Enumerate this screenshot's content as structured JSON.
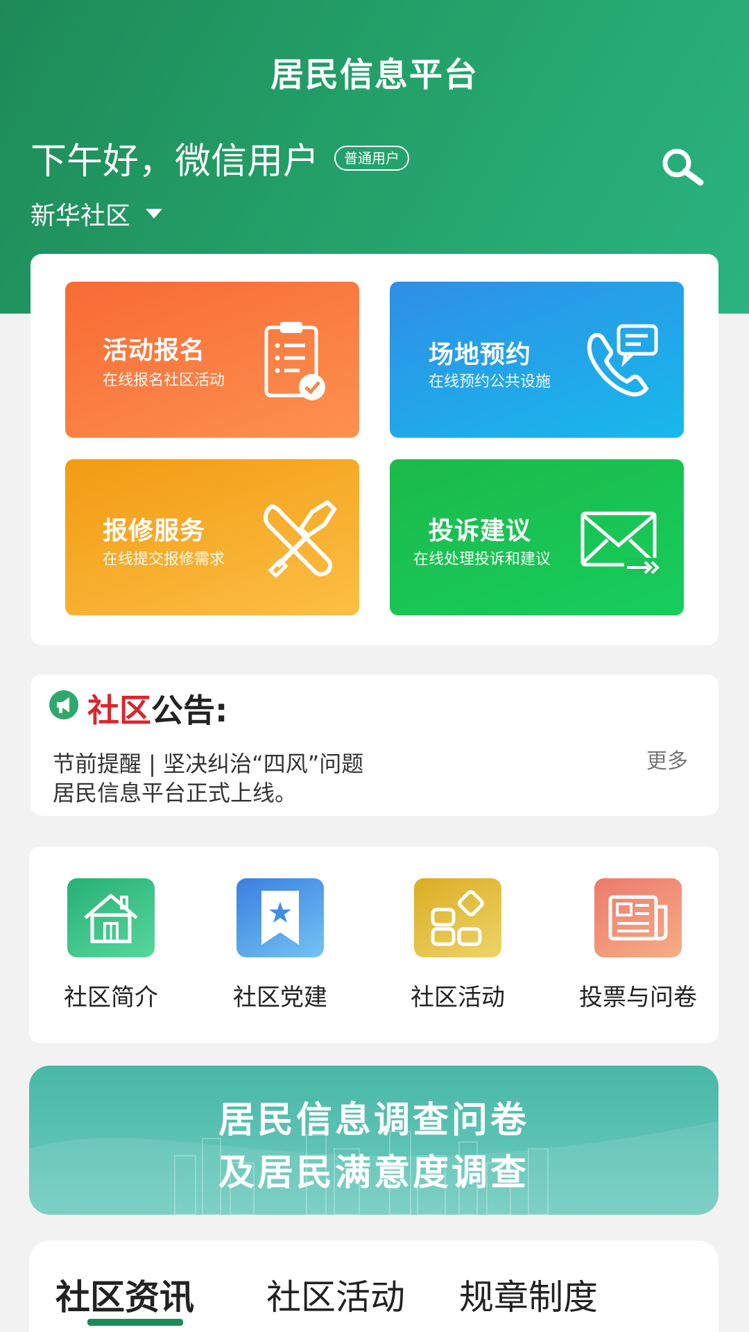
{
  "header": {
    "title": "居民信息平台",
    "greeting": "下午好，微信用户",
    "user_badge": "普通用户",
    "community": "新华社区",
    "search_icon": "search-icon",
    "color": "#24a46c"
  },
  "services": [
    {
      "title": "活动报名",
      "subtitle": "在线报名社区活动",
      "icon": "clipboard-check-icon",
      "color": "#f8743c"
    },
    {
      "title": "场地预约",
      "subtitle": "在线预约公共设施",
      "icon": "phone-chat-icon",
      "color": "#1ea8ea"
    },
    {
      "title": "报修服务",
      "subtitle": "在线提交报修需求",
      "icon": "wrench-hammer-icon",
      "color": "#f6aa26"
    },
    {
      "title": "投诉建议",
      "subtitle": "在线处理投诉和建议",
      "icon": "mail-forward-icon",
      "color": "#19c353"
    }
  ],
  "notice": {
    "title_red": "社区",
    "title_black": "公告:",
    "line1": "节前提醒 | 坚决纠治“四风”问题",
    "line2": "居民信息平台正式上线。",
    "more": "更多"
  },
  "quick_links": [
    {
      "label": "社区简介",
      "icon": "house-icon",
      "color": "#2dbd80"
    },
    {
      "label": "社区党建",
      "icon": "bookmark-star-icon",
      "color": "#3f8fe3"
    },
    {
      "label": "社区活动",
      "icon": "grid-apps-icon",
      "color": "#e0b934"
    },
    {
      "label": "投票与问卷",
      "icon": "newspaper-icon",
      "color": "#ee8275"
    }
  ],
  "banner": {
    "line1": "居民信息调查问卷",
    "line2": "及居民满意度调查"
  },
  "news_tabs": [
    "社区资讯",
    "社区活动",
    "规章制度"
  ],
  "active_tab": 0
}
